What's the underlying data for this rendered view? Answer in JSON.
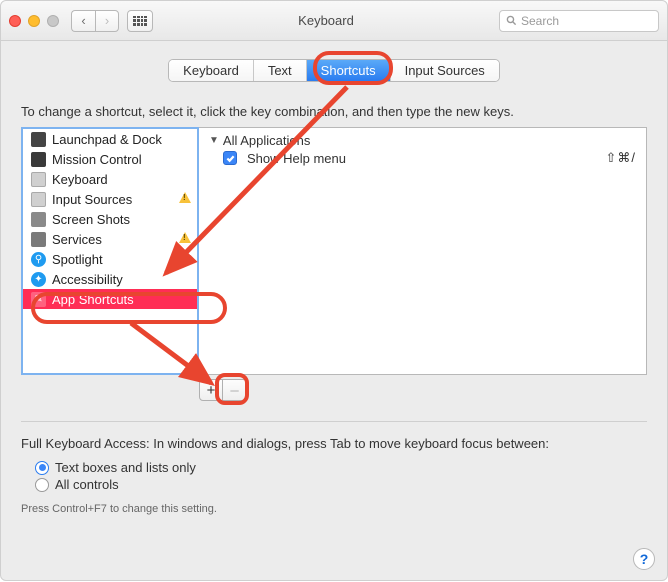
{
  "window": {
    "title": "Keyboard",
    "search_placeholder": "Search"
  },
  "tabs": [
    {
      "label": "Keyboard",
      "active": false
    },
    {
      "label": "Text",
      "active": false
    },
    {
      "label": "Shortcuts",
      "active": true
    },
    {
      "label": "Input Sources",
      "active": false
    }
  ],
  "instruction": "To change a shortcut, select it, click the key combination, and then type the new keys.",
  "categories": [
    {
      "label": "Launchpad & Dock",
      "icon_name": "launchpad-icon",
      "icon_bg": "#444",
      "warn": false
    },
    {
      "label": "Mission Control",
      "icon_name": "mission-control-icon",
      "icon_bg": "#3a3a3a",
      "warn": false
    },
    {
      "label": "Keyboard",
      "icon_name": "keyboard-icon",
      "icon_bg": "#bdbdbd",
      "warn": false
    },
    {
      "label": "Input Sources",
      "icon_name": "input-sources-icon",
      "icon_bg": "#bdbdbd",
      "warn": true
    },
    {
      "label": "Screen Shots",
      "icon_name": "screenshots-icon",
      "icon_bg": "#8a8a8a",
      "warn": false
    },
    {
      "label": "Services",
      "icon_name": "services-icon",
      "icon_bg": "#7a7a7a",
      "warn": true
    },
    {
      "label": "Spotlight",
      "icon_name": "spotlight-icon",
      "icon_bg": "#1f9bf0",
      "warn": false
    },
    {
      "label": "Accessibility",
      "icon_name": "accessibility-icon",
      "icon_bg": "#1f9bf0",
      "warn": false
    },
    {
      "label": "App Shortcuts",
      "icon_name": "app-shortcuts-icon",
      "icon_bg": "#e8452f",
      "warn": false,
      "selected": true
    }
  ],
  "detail": {
    "group_label": "All Applications",
    "items": [
      {
        "enabled": true,
        "label": "Show Help menu",
        "keys": "⇧⌘/"
      }
    ]
  },
  "plusminus": {
    "add": "+",
    "remove": "–"
  },
  "fk_access": {
    "label": "Full Keyboard Access: In windows and dialogs, press Tab to move keyboard focus between:",
    "options": [
      {
        "label": "Text boxes and lists only",
        "selected": true
      },
      {
        "label": "All controls",
        "selected": false
      }
    ],
    "hint": "Press Control+F7 to change this setting."
  },
  "help": "?"
}
